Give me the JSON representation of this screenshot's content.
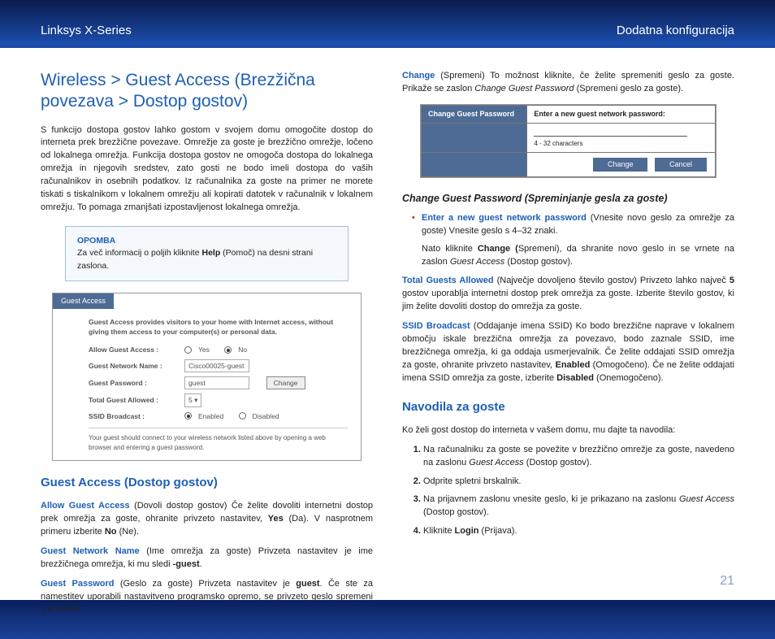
{
  "header": {
    "left": "Linksys X-Series",
    "right": "Dodatna konfiguracija"
  },
  "pageNumber": "21",
  "left": {
    "title": "Wireless > Guest Access (Brezžična povezava > Dostop gostov)",
    "intro": "S funkcijo dostopa gostov lahko gostom v svojem domu omogočite dostop do interneta prek brezžične povezave. Omrežje za goste je brezžično omrežje, ločeno od lokalnega omrežja. Funkcija dostopa gostov ne omogoča dostopa do lokalnega omrežja in njegovih sredstev, zato gosti ne bodo imeli dostopa do vaših računalnikov in osebnih podatkov. Iz računalnika za goste na primer ne morete tiskati s tiskalnikom v lokalnem omrežju ali kopirati datotek v računalnik v lokalnem omrežju. To pomaga zmanjšati izpostavljenost lokalnega omrežja.",
    "note": {
      "label": "OPOMBA",
      "text_before": "Za več informacij o poljih kliknite ",
      "help": "Help",
      "text_after": " (Pomoč) na desni strani zaslona."
    },
    "ss": {
      "tab": "Guest Access",
      "intro": "Guest Access provides visitors to your home with Internet access, without giving them access to your computer(s) or personal data.",
      "allowLabel": "Allow Guest Access :",
      "yes": "Yes",
      "no": "No",
      "nameLabel": "Guest Network Name :",
      "nameValue": "Cisco00025-guest",
      "changeBtn": "Change",
      "passLabel": "Guest Password :",
      "passValue": "guest",
      "totalLabel": "Total Guest Allowed :",
      "totalValue": "5",
      "ssidLabel": "SSID Broadcast :",
      "enabled": "Enabled",
      "disabled": "Disabled",
      "foot": "Your guest should connect to your wireless network listed above by opening a web browser and entering a guest password."
    },
    "guestAccessTitle": "Guest Access (Dostop gostov)",
    "p1": {
      "lead": "Allow Guest Access",
      "rest": " (Dovoli dostop gostov) Če želite dovoliti internetni dostop prek omrežja za goste, ohranite privzeto nastavitev, ",
      "yes": "Yes",
      "restb": " (Da). V nasprotnem primeru izberite ",
      "no": "No",
      "restc": " (Ne)."
    },
    "p2": {
      "lead": "Guest Network Name",
      "rest": " (Ime omrežja za goste) Privzeta nastavitev je ime brezžičnega omrežja, ki mu sledi ",
      "suffix": "-guest",
      "dot": "."
    },
    "p3": {
      "lead": "Guest Password",
      "rest": " (Geslo za goste) Privzeta nastavitev je ",
      "val": "guest",
      "restb": ". Če ste za namestitev uporabili nastavitveno programsko opremo, se privzeto geslo spremeni v enolično."
    }
  },
  "right": {
    "p0": {
      "lead": "Change",
      "rest": " (Spremeni)  To možnost kliknite, če želite spremeniti geslo za goste. Prikaže se zaslon ",
      "ital": "Change Guest Password",
      "restb": " (Spremeni geslo za goste)."
    },
    "cgp": {
      "title": "Change Guest Password",
      "prompt": "Enter a new guest network password:",
      "hint": "4 - 32 characters",
      "change": "Change",
      "cancel": "Cancel"
    },
    "subTitle": "Change Guest Password (Spreminjanje gesla za goste)",
    "b1": {
      "lead": "Enter a new guest network password",
      "rest": " (Vnesite novo geslo za omrežje za goste)  Vnesite geslo s 4–32 znaki."
    },
    "b1sub": {
      "a": "Nato kliknite ",
      "b": "Change (",
      "c": "Spremeni), da shranite novo geslo in se vrnete na zaslon ",
      "ital": "Guest Access",
      "d": " (Dostop gostov)."
    },
    "p4": {
      "lead": "Total Guests Allowed",
      "rest": " (Največje dovoljeno število gostov) Privzeto lahko največ ",
      "num": "5",
      "restb": " gostov uporablja internetni dostop prek omrežja za goste. Izberite število gostov, ki jim želite dovoliti dostop do omrežja za goste."
    },
    "p5": {
      "lead": "SSID Broadcast",
      "rest": " (Oddajanje imena SSID) Ko bodo brezžične naprave v lokalnem območju iskale brezžična omrežja za povezavo, bodo zaznale SSID, ime brezžičnega omrežja, ki ga oddaja usmerjevalnik. Če želite oddajati SSID omrežja za goste, ohranite privzeto nastavitev, ",
      "en": "Enabled",
      "restb": " (Omogočeno). Če ne želite oddajati imena SSID omrežja za goste, izberite ",
      "dis": "Disabled",
      "restc": " (Onemogočeno)."
    },
    "navTitle": "Navodila za goste",
    "navIntro": "Ko želi gost dostop do interneta v vašem domu, mu dajte ta navodila:",
    "steps": {
      "s1a": "Na računalniku za goste se povežite v brezžično omrežje za goste, navedeno na zaslonu ",
      "s1i": "Guest Access",
      "s1b": " (Dostop gostov).",
      "s2": "Odprite spletni brskalnik.",
      "s3a": "Na prijavnem zaslonu vnesite geslo, ki je prikazano na zaslonu ",
      "s3i": "Guest Access",
      "s3b": " (Dostop gostov).",
      "s4a": "Kliknite ",
      "s4b": "Login",
      "s4c": " (Prijava)."
    }
  }
}
